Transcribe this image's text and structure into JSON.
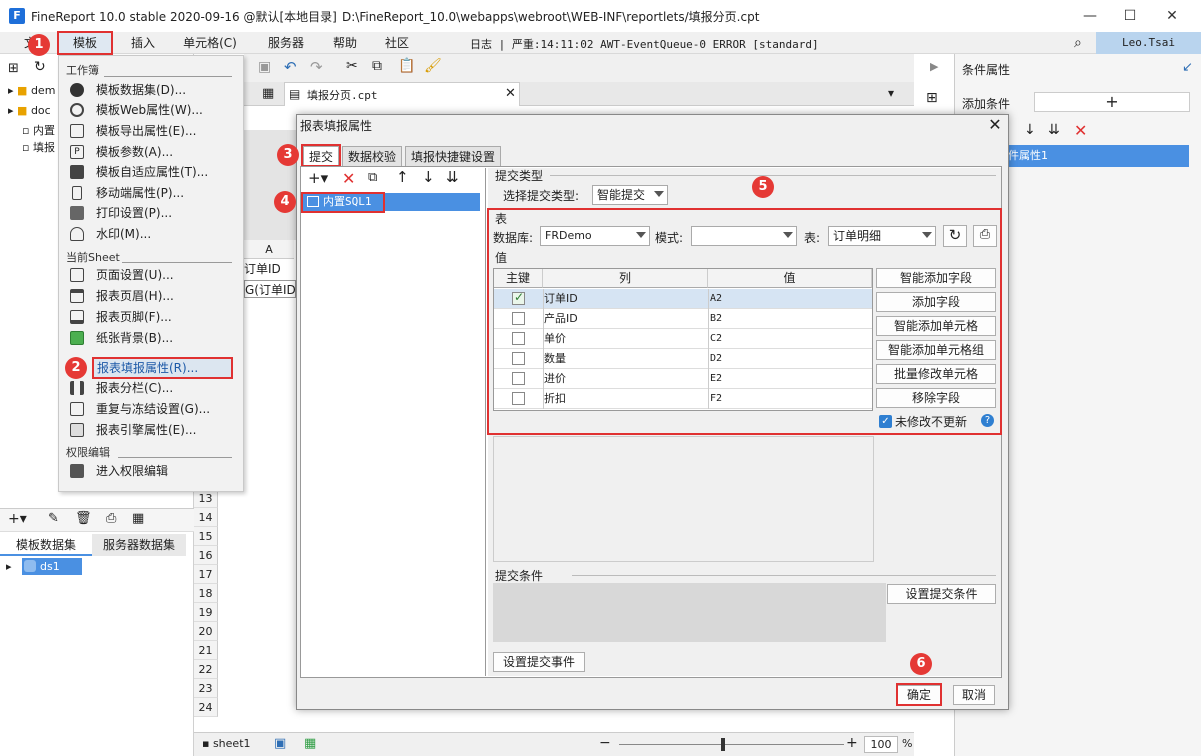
{
  "window": {
    "title": "FineReport 10.0 stable 2020-09-16 @默认[本地目录]",
    "path": "D:\\FineReport_10.0\\webapps\\webroot\\WEB-INF\\reportlets/填报分页.cpt"
  },
  "menubar": {
    "items": [
      "文件",
      "模板",
      "插入",
      "单元格(C)",
      "服务器",
      "帮助",
      "社区"
    ],
    "log": "日志 | 严重:14:11:02 AWT-EventQueue-0 ERROR [standard]",
    "user": "Leo.Tsai"
  },
  "left_tree": [
    "dem",
    "doc",
    "内置",
    "填报"
  ],
  "dataset_tabs": [
    "模板数据集",
    "服务器数据集"
  ],
  "dataset_item": "ds1",
  "file_tab": "填报分页.cpt",
  "sheet": {
    "cell_a1": "订单ID",
    "cell_a2": "G(订单ID",
    "col_header": "A",
    "rows": [
      "13",
      "14",
      "15",
      "16",
      "17",
      "18",
      "19",
      "20",
      "21",
      "22",
      "23",
      "24"
    ],
    "sheet_tab": "sheet1",
    "zoom": "100",
    "zoom_unit": "%"
  },
  "dropdown": {
    "section_workbook": "工作簿",
    "workbook_items": [
      "模板数据集(D)...",
      "模板Web属性(W)...",
      "模板导出属性(E)...",
      "模板参数(A)...",
      "模板自适应属性(T)...",
      "移动端属性(P)...",
      "打印设置(P)...",
      "水印(M)..."
    ],
    "section_sheet": "当前Sheet",
    "sheet_items": [
      "页面设置(U)...",
      "报表页眉(H)...",
      "报表页脚(F)...",
      "纸张背景(B)...",
      "报表填报属性(R)...",
      "报表分栏(C)...",
      "重复与冻结设置(G)...",
      "报表引擎属性(E)..."
    ],
    "section_perm": "权限编辑",
    "perm_items": [
      "进入权限编辑"
    ]
  },
  "right_panel": {
    "title": "条件属性",
    "add_label": "添加条件",
    "add_btn": "+",
    "selected": "件属性1"
  },
  "dialog": {
    "title": "报表填报属性",
    "tabs": [
      "提交",
      "数据校验",
      "填报快捷键设置"
    ],
    "list_item": "内置SQL1",
    "submit_type_section": "提交类型",
    "submit_type_label": "选择提交类型:",
    "submit_type_value": "智能提交",
    "table_section": "表",
    "db_label": "数据库:",
    "db_value": "FRDemo",
    "mode_label": "模式:",
    "mode_value": "",
    "table_label": "表:",
    "table_value": "订单明细",
    "value_section": "值",
    "columns": [
      "主键",
      "列",
      "值"
    ],
    "rows": [
      {
        "key": true,
        "col": "订单ID",
        "val": "A2"
      },
      {
        "key": false,
        "col": "产品ID",
        "val": "B2"
      },
      {
        "key": false,
        "col": "单价",
        "val": "C2"
      },
      {
        "key": false,
        "col": "数量",
        "val": "D2"
      },
      {
        "key": false,
        "col": "进价",
        "val": "E2"
      },
      {
        "key": false,
        "col": "折扣",
        "val": "F2"
      }
    ],
    "side_buttons": [
      "智能添加字段",
      "添加字段",
      "智能添加单元格",
      "智能添加单元格组",
      "批量修改单元格",
      "移除字段"
    ],
    "no_update_label": "未修改不更新",
    "submit_condition_section": "提交条件",
    "set_condition_btn": "设置提交条件",
    "set_event_btn": "设置提交事件",
    "ok": "确定",
    "cancel": "取消"
  },
  "badges": [
    "1",
    "2",
    "3",
    "4",
    "5",
    "6"
  ],
  "colors": {
    "accent": "#4a90e2",
    "highlight": "#e03131"
  }
}
